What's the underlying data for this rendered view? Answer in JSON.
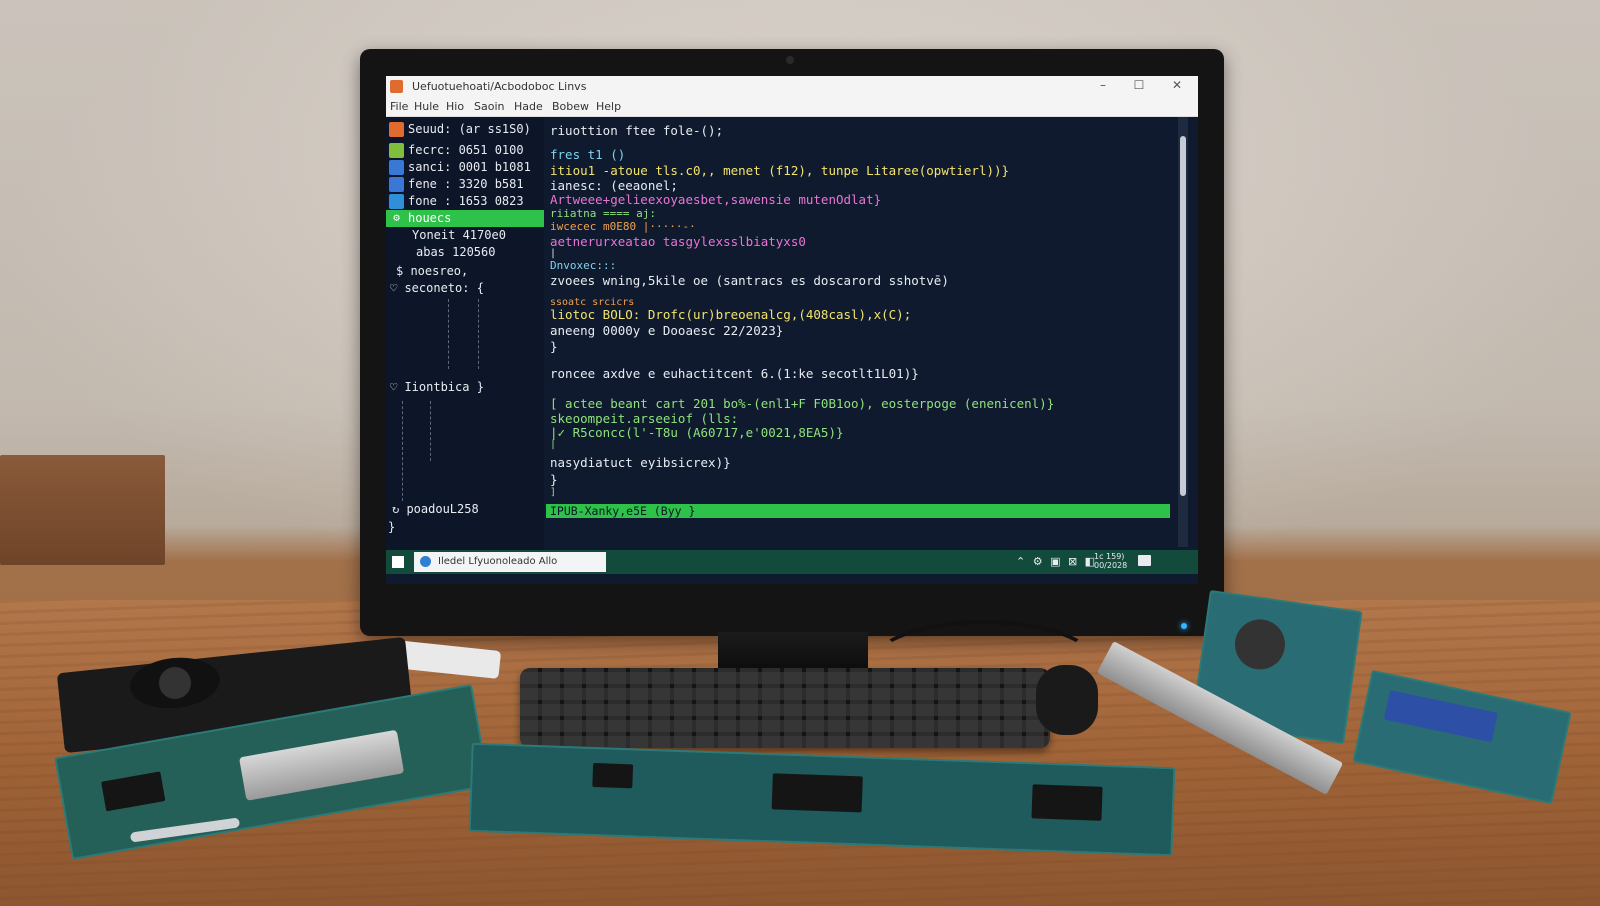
{
  "window": {
    "title": "Uefuotuehoati/Acbodoboc Linvs",
    "controls": {
      "minimize": "–",
      "maximize": "☐",
      "close": "✕"
    }
  },
  "menu": [
    "File",
    "Hule",
    "Hio",
    "Saoin",
    "Hade",
    "Bobew",
    "Help"
  ],
  "sidebar": {
    "items": [
      {
        "label": "Seuud: (ar ss1S0)",
        "icon": "orange-app-icon",
        "color": "#e06b2e"
      },
      {
        "label": "fecrc:  0651 0100",
        "icon": "green-app-icon",
        "color": "#7fbf3c"
      },
      {
        "label": "sanci:  0001 b1081",
        "icon": "blue-app-icon",
        "color": "#3a78d6"
      },
      {
        "label": "fene :  3320 b581",
        "icon": "blue-app-icon",
        "color": "#3a78d6"
      },
      {
        "label": "fone :  1653 0823",
        "icon": "vscode-icon",
        "color": "#2f8fd8"
      },
      {
        "label": "houecs",
        "icon": "gear-icon",
        "highlighted": true
      },
      {
        "label": "Yoneit  4170e0"
      },
      {
        "label": "abas  120560"
      },
      {
        "label": "$ noesreo,"
      },
      {
        "label": "♡ seconeto: {"
      },
      {
        "label": "♡ Iiontbica }"
      },
      {
        "label": "↻ poadouL258"
      },
      {
        "label": "}"
      }
    ]
  },
  "code_lines": [
    {
      "text": "riuottion ftee fole-();",
      "color": "#e8ecf2"
    },
    {
      "text": "fres t1 ()",
      "color": "#7fd3ef"
    },
    {
      "text": "itiou1 -atoue tls.c0,, menet (f12), tunpe Litaree(opwtierl))}",
      "color": "#f3e46b"
    },
    {
      "text": "ianesc: (eeaonel;",
      "color": "#e8ecf2"
    },
    {
      "text": "Artweee+gelieexoyaesbet,sawensie mutenOdlat}",
      "color": "#ec73d6"
    },
    {
      "text": "riiatna ==== aj:",
      "color": "#8fe37a"
    },
    {
      "text": "iwcecec m0E80 |·····-·",
      "color": "#f2a04a"
    },
    {
      "text": "aetnerurxeatao tasgylexsslbiatyxs0",
      "color": "#ec73d6"
    },
    {
      "text": "|",
      "color": "#e8ecf2"
    },
    {
      "text": "Dnvoxec:::",
      "color": "#7fd3ef"
    },
    {
      "text": "zvoees wning,5kile oe (santracs es doscarord sshotvē)",
      "color": "#e8ecf2"
    },
    {
      "text": "ssoatc srcicrs",
      "color": "#f2a04a"
    },
    {
      "text": "liotoc BOLO: Drofc(ur)breoenalcg,(408casl),x(C);",
      "color": "#f3e46b"
    },
    {
      "text": "aneeng 0000y e Dooaesc 22/2023}",
      "color": "#e8ecf2"
    },
    {
      "text": "}",
      "color": "#e8ecf2"
    },
    {
      "text": "roncee axdve e euhactitcent 6.(1:ke secotlt1L01)}",
      "color": "#e8ecf2"
    },
    {
      "text": "[ actee beant cart 201 bo%-(enl1+F F0B1oo), eosterpoge (enenicenl)}",
      "color": "#8fe37a"
    },
    {
      "text": "  skeoompeit.arseeiof (lls:",
      "color": "#8fe37a"
    },
    {
      "text": "|✓     R5concc(l'-T8u (A60717,e'0021,8EA5)}",
      "color": "#8fe37a"
    },
    {
      "text": "|",
      "color": "#8fe37a"
    },
    {
      "text": " nasydiatuct eyibsicrex)}",
      "color": "#e8ecf2"
    },
    {
      "text": "}",
      "color": "#e8ecf2"
    },
    {
      "text": "]",
      "color": "#8fe37a"
    }
  ],
  "status_highlight": "IPUB-Xanky,e5E (Byy }",
  "taskbar": {
    "task_label": "Iledel Lfyuonoleado Allo",
    "tray": "⌃ ⚙ ▣ ⊠ ◧",
    "clock_line1": "1c 159)",
    "clock_line2": "00/2028"
  },
  "colors": {
    "screen_bg": "#0f1a2e",
    "highlight_green": "#2ec24a",
    "taskbar": "#124a3b"
  }
}
